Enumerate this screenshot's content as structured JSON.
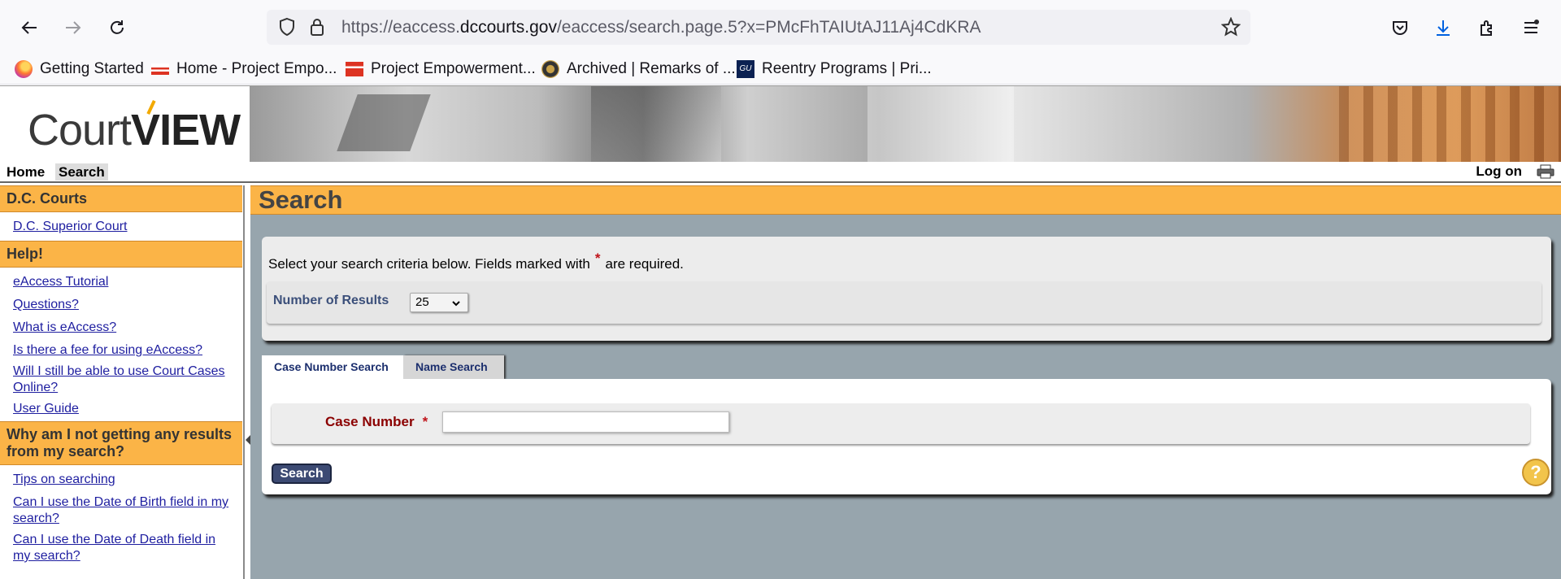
{
  "browser": {
    "url_prefix": "https://eaccess.",
    "url_domain": "dccourts.gov",
    "url_path": "/eaccess/search.page.5?x=PMcFhTAIUtAJ11Aj4CdKRA"
  },
  "bookmarks": [
    {
      "label": "Getting Started",
      "icon": "firefox-icon"
    },
    {
      "label": "Home - Project Empo...",
      "icon": "dc-flag-icon"
    },
    {
      "label": "Project Empowerment...",
      "icon": "dc-flag-icon"
    },
    {
      "label": "Archived | Remarks of ...",
      "icon": "seal-icon"
    },
    {
      "label": "Reentry Programs | Pri...",
      "icon": "gu-icon"
    }
  ],
  "header": {
    "logo_court": "Court",
    "logo_view": "VIEW"
  },
  "nav": {
    "home": "Home",
    "search": "Search",
    "logon": "Log on"
  },
  "sidebar": {
    "sections": [
      {
        "title": "D.C. Courts",
        "links": [
          "D.C. Superior Court"
        ]
      },
      {
        "title": "Help!",
        "links": [
          "eAccess Tutorial",
          "Questions?",
          "What is eAccess?",
          "Is there a fee for using eAccess?",
          "Will I still be able to use Court Cases Online?",
          "User Guide"
        ]
      },
      {
        "title": "Why am I not getting any results from my search?",
        "links": [
          "Tips on searching",
          "Can I use the Date of Birth field in my search?",
          "Can I use the Date of Death field in my search?"
        ]
      }
    ]
  },
  "main": {
    "title": "Search",
    "criteria_text_before": "Select your search criteria below. Fields marked with",
    "criteria_star": "*",
    "criteria_text_after": "are required.",
    "results_label": "Number of Results",
    "results_value": "25",
    "tabs": [
      {
        "label": "Case Number Search",
        "active": true
      },
      {
        "label": "Name Search",
        "active": false
      }
    ],
    "case_number_label": "Case Number",
    "case_number_value": "",
    "search_button": "Search",
    "help_icon": "?"
  },
  "colors": {
    "accent_orange": "#fbb447",
    "main_bg": "#97a5ad",
    "link": "#1e1ea0",
    "required": "#c0141a"
  }
}
